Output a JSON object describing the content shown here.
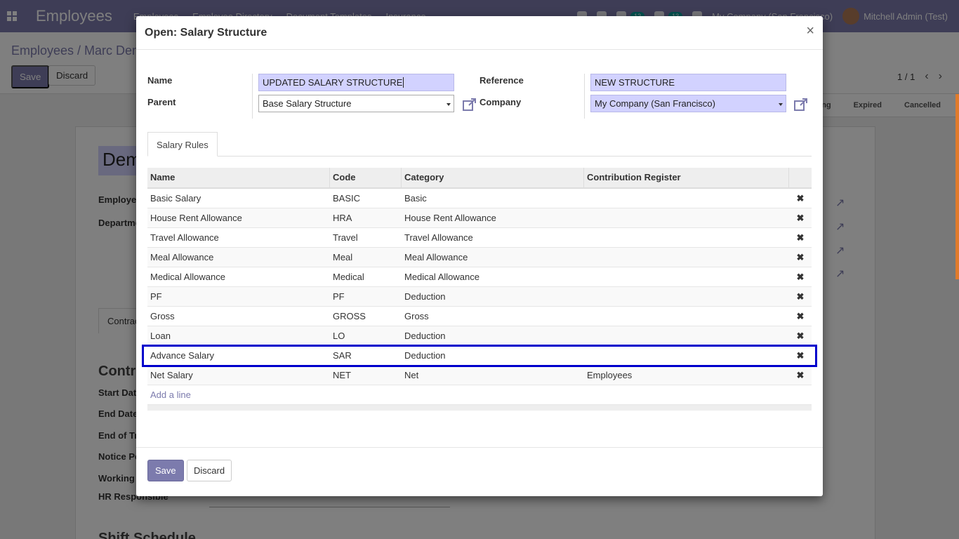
{
  "app": {
    "title": "Employees",
    "nav": [
      "Employees",
      "Employee Directory",
      "Document Templates",
      "Insurance"
    ],
    "company": "My Company (San Francisco)",
    "user": "Mitchell Admin (Test)",
    "badges": [
      "12",
      "13"
    ]
  },
  "control_panel": {
    "breadcrumb": "Employees / Marc Demo",
    "save_label": "Save",
    "discard_label": "Discard",
    "pager": "1 / 1"
  },
  "statusbar": {
    "stages": [
      "Running",
      "Expired",
      "Cancelled"
    ]
  },
  "sheet": {
    "name_fragment": "Dem",
    "labels": [
      "Employee",
      "Department"
    ],
    "contract_tab": "Contract",
    "section_title": "Contract",
    "field_labels": [
      "Start Date",
      "End Date",
      "End of Trial",
      "Notice Period",
      "Working Schedule",
      "HR Responsible"
    ],
    "shift_section": "Shift Schedule"
  },
  "modal": {
    "title": "Open: Salary Structure",
    "close_glyph": "×",
    "form": {
      "name_label": "Name",
      "name_value": "UPDATED SALARY STRUCTURE",
      "parent_label": "Parent",
      "parent_value": "Base Salary Structure",
      "reference_label": "Reference",
      "reference_value": "NEW STRUCTURE",
      "company_label": "Company",
      "company_value": "My Company (San Francisco)"
    },
    "tabs": [
      "Salary Rules"
    ],
    "table": {
      "columns": [
        "Name",
        "Code",
        "Category",
        "Contribution Register"
      ],
      "rows": [
        {
          "name": "Basic Salary",
          "code": "BASIC",
          "category": "Basic",
          "register": ""
        },
        {
          "name": "House Rent Allowance",
          "code": "HRA",
          "category": "House Rent Allowance",
          "register": ""
        },
        {
          "name": "Travel Allowance",
          "code": "Travel",
          "category": "Travel Allowance",
          "register": ""
        },
        {
          "name": "Meal Allowance",
          "code": "Meal",
          "category": "Meal Allowance",
          "register": ""
        },
        {
          "name": "Medical Allowance",
          "code": "Medical",
          "category": "Medical Allowance",
          "register": ""
        },
        {
          "name": "PF",
          "code": "PF",
          "category": "Deduction",
          "register": ""
        },
        {
          "name": "Gross",
          "code": "GROSS",
          "category": "Gross",
          "register": ""
        },
        {
          "name": "Loan",
          "code": "LO",
          "category": "Deduction",
          "register": ""
        },
        {
          "name": "Advance Salary",
          "code": "SAR",
          "category": "Deduction",
          "register": ""
        },
        {
          "name": "Net Salary",
          "code": "NET",
          "category": "Net",
          "register": "Employees"
        }
      ],
      "delete_glyph": "✖",
      "add_line_label": "Add a line",
      "highlighted_row": "Advance Salary"
    },
    "footer": {
      "save_label": "Save",
      "discard_label": "Discard"
    }
  },
  "colors": {
    "brand": "#7c7bad",
    "required_field": "#d2d2ff",
    "highlight_outline": "#0000cc"
  }
}
